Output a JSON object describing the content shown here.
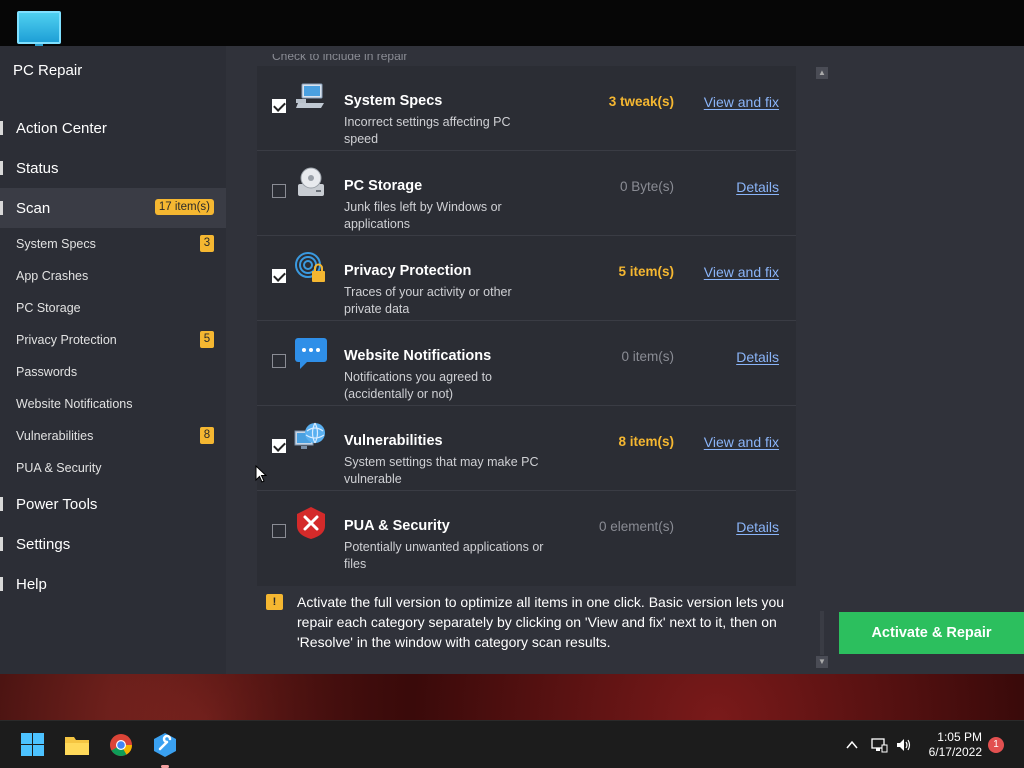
{
  "app": {
    "title": "PC Repair",
    "header_clipped": "Check to include in repair"
  },
  "sidebar": {
    "main": [
      {
        "label": "Action Center"
      },
      {
        "label": "Status"
      },
      {
        "label": "Scan",
        "badge": "17 item(s)"
      },
      {
        "label": "Power Tools"
      },
      {
        "label": "Settings"
      },
      {
        "label": "Help"
      }
    ],
    "scan_items": [
      {
        "label": "System Specs",
        "badge": "3"
      },
      {
        "label": "App Crashes"
      },
      {
        "label": "PC Storage"
      },
      {
        "label": "Privacy Protection",
        "badge": "5"
      },
      {
        "label": "Passwords"
      },
      {
        "label": "Website Notifications"
      },
      {
        "label": "Vulnerabilities",
        "badge": "8"
      },
      {
        "label": "PUA & Security"
      }
    ]
  },
  "categories": [
    {
      "title": "System Specs",
      "desc": "Incorrect settings affecting PC speed",
      "count": "3 tweak(s)",
      "action": "View and fix",
      "checked": true,
      "icon": "laptop-icon"
    },
    {
      "title": "PC Storage",
      "desc": "Junk files left by Windows or applications",
      "count": "0 Byte(s)",
      "action": "Details",
      "checked": false,
      "icon": "disk-icon"
    },
    {
      "title": "Privacy Protection",
      "desc": "Traces of your activity or other private data",
      "count": "5 item(s)",
      "action": "View and fix",
      "checked": true,
      "icon": "fingerprint-lock-icon"
    },
    {
      "title": "Website Notifications",
      "desc": "Notifications you agreed to (accidentally or not)",
      "count": "0 item(s)",
      "action": "Details",
      "checked": false,
      "icon": "chat-bubble-icon"
    },
    {
      "title": "Vulnerabilities",
      "desc": "System settings that may make PC vulnerable",
      "count": "8 item(s)",
      "action": "View and fix",
      "checked": true,
      "icon": "globe-monitor-icon"
    },
    {
      "title": "PUA & Security",
      "desc": "Potentially unwanted applications or files",
      "count": "0 element(s)",
      "action": "Details",
      "checked": false,
      "icon": "red-x-icon"
    }
  ],
  "info": {
    "icon": "!",
    "text": "Activate the full version to optimize all items in one click. Basic version lets you repair each category separately by clicking on 'View and fix' next to it, then on 'Resolve' in the window with category scan results."
  },
  "activate_button": "Activate & Repair",
  "taskbar": {
    "time": "1:05 PM",
    "date": "6/17/2022",
    "notification_count": "1"
  },
  "colors": {
    "accent": "#f5b731",
    "link": "#8ab4f8",
    "activate": "#2cbf5e"
  }
}
